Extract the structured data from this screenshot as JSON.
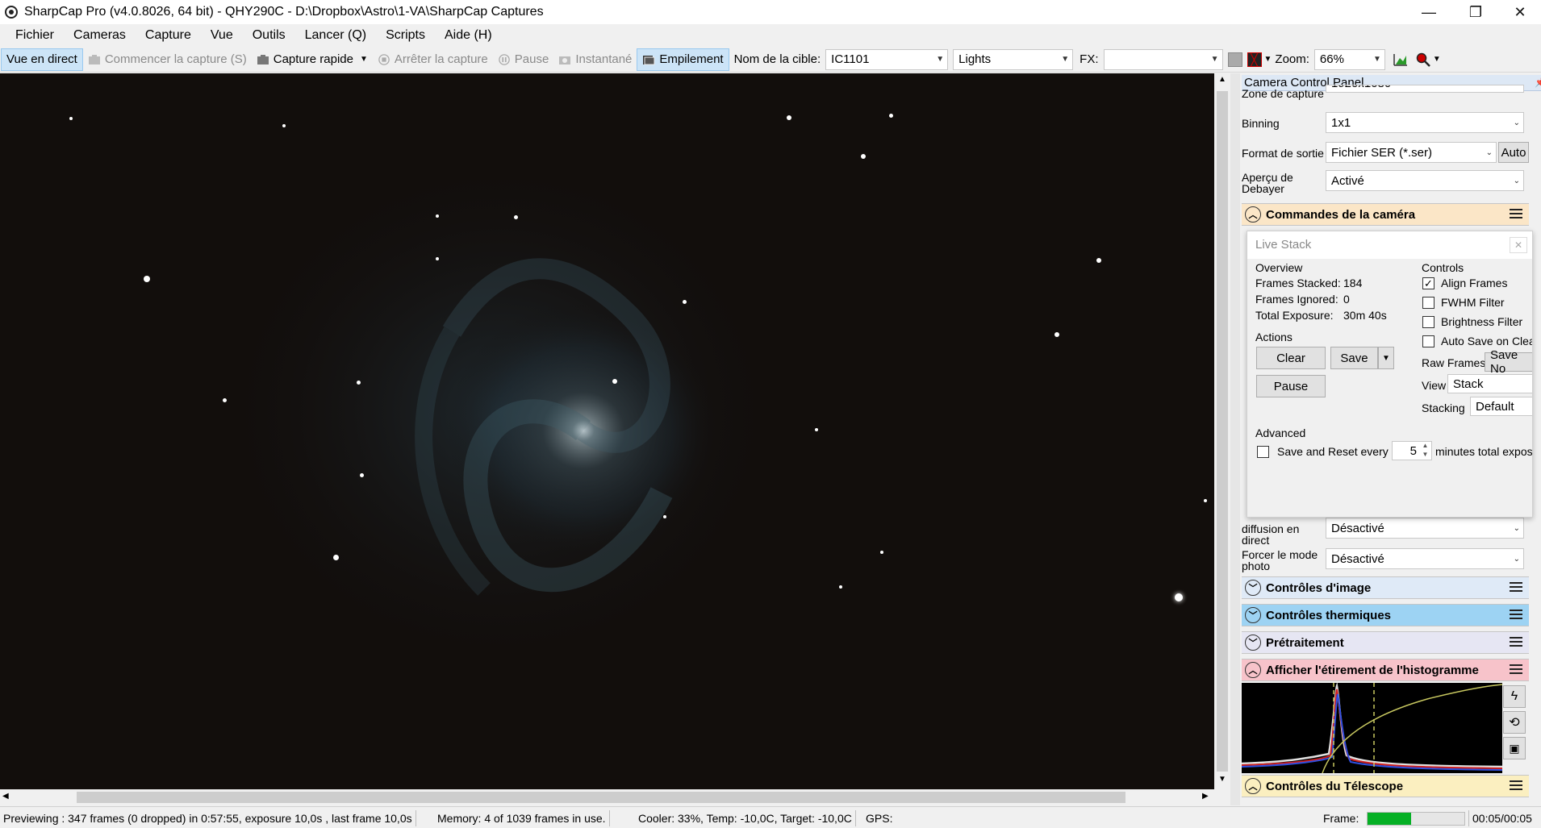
{
  "window": {
    "title": "SharpCap Pro (v4.0.8026, 64 bit) - QHY290C - D:\\Dropbox\\Astro\\1-VA\\SharpCap Captures",
    "minimize": "—",
    "maximize": "❐",
    "close": "✕"
  },
  "menu": [
    "Fichier",
    "Cameras",
    "Capture",
    "Vue",
    "Outils",
    "Lancer (Q)",
    "Scripts",
    "Aide (H)"
  ],
  "toolbar": {
    "live_view": "Vue en direct",
    "start_capture": "Commencer la capture (S)",
    "quick_capture": "Capture rapide",
    "stop_capture": "Arrêter la capture",
    "pause": "Pause",
    "snapshot": "Instantané",
    "stacking": "Empilement",
    "target_label": "Nom de la cible:",
    "target_value": "IC1101",
    "frame_type": "Lights",
    "fx_label": "FX:",
    "fx_value": "",
    "zoom_label": "Zoom:",
    "zoom_value": "66%"
  },
  "panel": {
    "title": "Camera Control Panel",
    "props": [
      {
        "label": "Zone de capture",
        "value": "1920x1080"
      },
      {
        "label": "Binning",
        "value": "1x1"
      },
      {
        "label": "Format de sortie",
        "value": "Fichier SER (*.ser)",
        "button": "Auto"
      },
      {
        "label": "Aperçu de Debayer",
        "value": "Activé"
      }
    ],
    "camera_controls": "Commandes de la caméra",
    "lower_props": [
      {
        "label": "diffusion en direct",
        "value": "Désactivé"
      },
      {
        "label": "Forcer le mode photo",
        "value": "Désactivé"
      }
    ],
    "sections": [
      {
        "label": "Contrôles d'image",
        "color": "#dfeaf7"
      },
      {
        "label": "Contrôles thermiques",
        "color": "#9dd3f3"
      },
      {
        "label": "Prétraitement",
        "color": "#e6e6f3"
      },
      {
        "label": "Afficher l'étirement de l'histogramme",
        "color": "#f7c3ca"
      },
      {
        "label": "Contrôles du Télescope",
        "color": "#fbefc0"
      }
    ]
  },
  "live_stack": {
    "title": "Live Stack",
    "overview_label": "Overview",
    "frames_stacked_label": "Frames Stacked:",
    "frames_stacked": "184",
    "frames_ignored_label": "Frames Ignored:",
    "frames_ignored": "0",
    "total_exposure_label": "Total Exposure:",
    "total_exposure": "30m 40s",
    "actions_label": "Actions",
    "clear": "Clear",
    "save": "Save",
    "pause": "Pause",
    "controls_label": "Controls",
    "align_frames": "Align Frames",
    "fwhm_filter": "FWHM Filter",
    "brightness_filter": "Brightness Filter",
    "auto_save": "Auto Save on Clea",
    "raw_frames_label": "Raw Frames",
    "raw_frames_btn": "Save No",
    "view_label": "View",
    "view_value": "Stack",
    "stacking_label": "Stacking",
    "stacking_value": "Default",
    "advanced_label": "Advanced",
    "save_reset_label": "Save and Reset every",
    "save_reset_value": "5",
    "save_reset_suffix": "minutes total exposu"
  },
  "status": {
    "preview": "Previewing : 347 frames (0 dropped) in 0:57:55, exposure 10,0s , last frame 10,0s",
    "memory": "Memory: 4 of 1039 frames in use.",
    "cooler": "Cooler: 33%, Temp: -10,0C, Target: -10,0C",
    "gps": "GPS:",
    "frame_label": "Frame:",
    "frame_time": "00:05/00:05",
    "frame_progress": 0.45
  }
}
